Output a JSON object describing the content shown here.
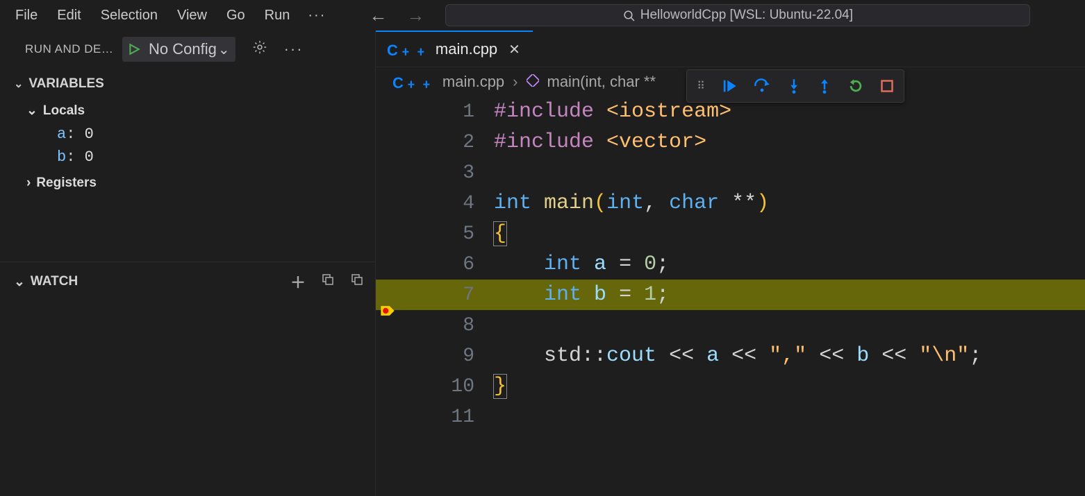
{
  "menubar": {
    "items": [
      "File",
      "Edit",
      "Selection",
      "View",
      "Go",
      "Run"
    ],
    "more": "···"
  },
  "search": {
    "text": "HelloworldCpp [WSL: Ubuntu-22.04]"
  },
  "run_debug": {
    "title": "RUN AND DE…",
    "config_label": "No Config",
    "chevron": "⌄"
  },
  "variables": {
    "title": "VARIABLES",
    "locals_label": "Locals",
    "locals": [
      {
        "name": "a",
        "value": "0"
      },
      {
        "name": "b",
        "value": "0"
      }
    ],
    "registers_label": "Registers"
  },
  "watch": {
    "title": "WATCH"
  },
  "tab": {
    "filename": "main.cpp"
  },
  "breadcrumb": {
    "file": "main.cpp",
    "symbol": "main(int, char **"
  },
  "debug_toolbar": {
    "buttons": [
      "continue",
      "step-over",
      "step-into",
      "step-out",
      "restart",
      "stop"
    ]
  },
  "code": {
    "lines": [
      {
        "n": 1,
        "tokens": [
          [
            "tk-include",
            "#include"
          ],
          [
            "",
            ""
          ],
          [
            "",
            " "
          ],
          [
            "tk-angle",
            "<iostream>"
          ]
        ]
      },
      {
        "n": 2,
        "tokens": [
          [
            "tk-include",
            "#include"
          ],
          [
            "",
            " "
          ],
          [
            "tk-angle",
            "<vector>"
          ]
        ]
      },
      {
        "n": 3,
        "tokens": []
      },
      {
        "n": 4,
        "tokens": [
          [
            "tk-kw",
            "int"
          ],
          [
            "",
            " "
          ],
          [
            "tk-func",
            "main"
          ],
          [
            "tk-paren",
            "("
          ],
          [
            "tk-kw",
            "int"
          ],
          [
            "tk-op",
            ", "
          ],
          [
            "tk-kw",
            "char"
          ],
          [
            "",
            " "
          ],
          [
            "tk-op",
            "**"
          ],
          [
            "tk-paren",
            ")"
          ]
        ]
      },
      {
        "n": 5,
        "tokens": [
          [
            "tk-brace tk-brace-box",
            "{"
          ]
        ]
      },
      {
        "n": 6,
        "tokens": [
          [
            "",
            "    "
          ],
          [
            "tk-kw",
            "int"
          ],
          [
            "",
            " "
          ],
          [
            "tk-id",
            "a"
          ],
          [
            "",
            " "
          ],
          [
            "tk-op",
            "="
          ],
          [
            "",
            " "
          ],
          [
            "tk-num",
            "0"
          ],
          [
            "tk-op",
            ";"
          ]
        ]
      },
      {
        "n": 7,
        "current": true,
        "tokens": [
          [
            "",
            "    "
          ],
          [
            "tk-kw",
            "int"
          ],
          [
            "",
            " "
          ],
          [
            "tk-id",
            "b"
          ],
          [
            "",
            " "
          ],
          [
            "tk-op",
            "="
          ],
          [
            "",
            " "
          ],
          [
            "tk-num",
            "1"
          ],
          [
            "tk-op",
            ";"
          ]
        ]
      },
      {
        "n": 8,
        "tokens": []
      },
      {
        "n": 9,
        "tokens": [
          [
            "",
            "    "
          ],
          [
            "tk-ns",
            "std"
          ],
          [
            "tk-op",
            "::"
          ],
          [
            "tk-id",
            "cout"
          ],
          [
            "",
            " "
          ],
          [
            "tk-op",
            "<<"
          ],
          [
            "",
            " "
          ],
          [
            "tk-id",
            "a"
          ],
          [
            "",
            " "
          ],
          [
            "tk-op",
            "<<"
          ],
          [
            "",
            " "
          ],
          [
            "tk-str",
            "\",\""
          ],
          [
            "",
            " "
          ],
          [
            "tk-op",
            "<<"
          ],
          [
            "",
            " "
          ],
          [
            "tk-id",
            "b"
          ],
          [
            "",
            " "
          ],
          [
            "tk-op",
            "<<"
          ],
          [
            "",
            " "
          ],
          [
            "tk-str",
            "\"\\n\""
          ],
          [
            "tk-op",
            ";"
          ]
        ]
      },
      {
        "n": 10,
        "tokens": [
          [
            "tk-brace tk-brace-box",
            "}"
          ]
        ]
      },
      {
        "n": 11,
        "tokens": []
      }
    ]
  }
}
